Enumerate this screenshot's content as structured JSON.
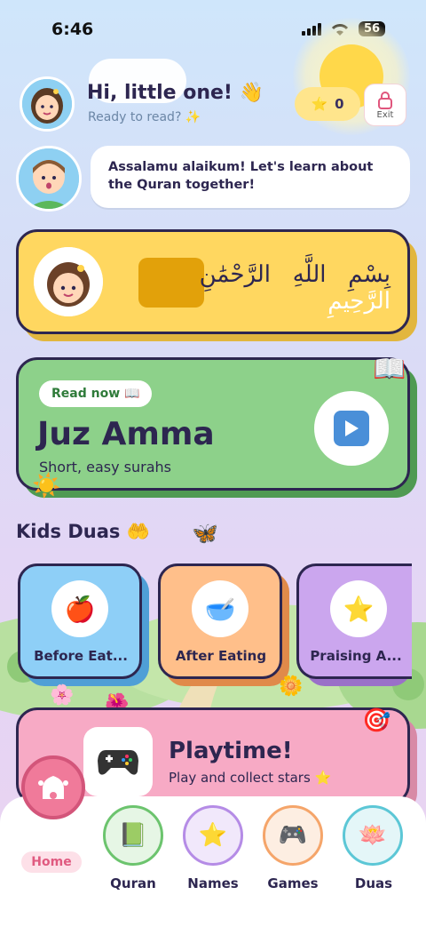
{
  "status": {
    "time": "6:46",
    "battery": "56"
  },
  "header": {
    "greeting": "Hi, little one! 👋",
    "subtitle": "Ready to read? ✨",
    "stars": "0",
    "exit_label": "Exit"
  },
  "speech": {
    "message": "Assalamu alaikum! Let's learn about the Quran together!"
  },
  "bismillah": {
    "words": [
      "بِسْمِ",
      "اللَّهِ",
      "الرَّحْمَٰنِ",
      "الرَّحِيمِ"
    ],
    "highlighted_index": 3
  },
  "featured": {
    "pill": "Read now 📖",
    "title": "Juz Amma",
    "subtitle": "Short, easy surahs",
    "corner_icon": "📖",
    "sun_icon": "☀️"
  },
  "duas": {
    "title": "Kids Duas 🤲",
    "items": [
      {
        "label": "Before Eat...",
        "icon": "🍎",
        "bg": "#8ecff7",
        "shadow": "#4f9fd6"
      },
      {
        "label": "After Eating",
        "icon": "🥣",
        "bg": "#ffbf8a",
        "shadow": "#e08a4a"
      },
      {
        "label": "Praising A...",
        "icon": "⭐",
        "bg": "#cba6ee",
        "shadow": "#9a70c8"
      }
    ]
  },
  "playtime": {
    "title": "Playtime!",
    "subtitle": "Play and collect stars ⭐",
    "icon": "🎮",
    "corner": "🎯"
  },
  "nav": {
    "home": "Home",
    "items": [
      {
        "label": "Quran",
        "icon": "📗",
        "color": "#6cc46e",
        "bg": "#e6f6e5"
      },
      {
        "label": "Names",
        "icon": "⭐",
        "color": "#b58ce6",
        "bg": "#f1e8fb"
      },
      {
        "label": "Games",
        "icon": "🎮",
        "color": "#f5a56a",
        "bg": "#fdeee2"
      },
      {
        "label": "Duas",
        "icon": "🪷",
        "color": "#5cc7d6",
        "bg": "#e4f6f8"
      }
    ]
  }
}
